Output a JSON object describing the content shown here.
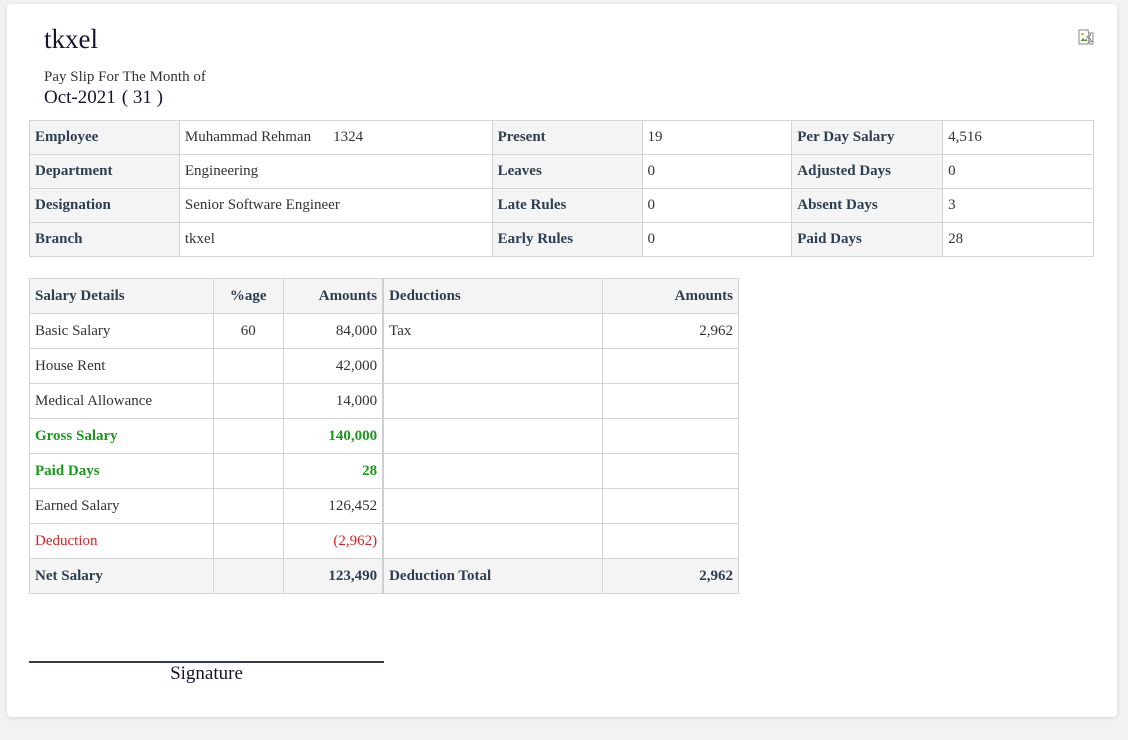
{
  "header": {
    "company": "tkxel",
    "slip_label": "Pay Slip For The Month of",
    "period": "Oct-2021",
    "period_days": "( 31 )"
  },
  "employee_info": {
    "rows": [
      {
        "l1": "Employee",
        "v1": "Muhammad Rehman",
        "v1b": "1324",
        "l2": "Present",
        "v2": "19",
        "l3": "Per Day Salary",
        "v3": "4,516"
      },
      {
        "l1": "Department",
        "v1": "Engineering",
        "l2": "Leaves",
        "v2": "0",
        "l3": "Adjusted Days",
        "v3": "0"
      },
      {
        "l1": "Designation",
        "v1": "Senior Software Engineer",
        "l2": "Late Rules",
        "v2": "0",
        "l3": "Absent Days",
        "v3": "3"
      },
      {
        "l1": "Branch",
        "v1": "tkxel",
        "l2": "Early Rules",
        "v2": "0",
        "l3": "Paid Days",
        "v3": "28"
      }
    ]
  },
  "salary": {
    "headers": {
      "details": "Salary Details",
      "pct": "%age",
      "amounts": "Amounts",
      "deductions": "Deductions",
      "ded_amounts": "Amounts"
    },
    "rows": [
      {
        "label": "Basic Salary",
        "pct": "60",
        "amount": "84,000",
        "ded_label": "Tax",
        "ded_amount": "2,962"
      },
      {
        "label": "House Rent",
        "pct": "",
        "amount": "42,000",
        "ded_label": "",
        "ded_amount": ""
      },
      {
        "label": "Medical Allowance",
        "pct": "",
        "amount": "14,000",
        "ded_label": "",
        "ded_amount": ""
      },
      {
        "label": "Gross Salary",
        "pct": "",
        "amount": "140,000",
        "ded_label": "",
        "ded_amount": ""
      },
      {
        "label": "Paid Days",
        "pct": "",
        "amount": "28",
        "ded_label": "",
        "ded_amount": ""
      },
      {
        "label": "Earned Salary",
        "pct": "",
        "amount": "126,452",
        "ded_label": "",
        "ded_amount": ""
      },
      {
        "label": "Deduction",
        "pct": "",
        "amount": "(2,962)",
        "ded_label": "",
        "ded_amount": ""
      }
    ],
    "footer": {
      "label": "Net Salary",
      "pct": "",
      "amount": "123,490",
      "ded_label": "Deduction Total",
      "ded_amount": "2,962"
    }
  },
  "signature": {
    "label": "Signature"
  },
  "colors": {
    "highlight_green": "#1a9a1a",
    "deduction_red": "#e02020",
    "header_bg": "#f4f4f4"
  }
}
